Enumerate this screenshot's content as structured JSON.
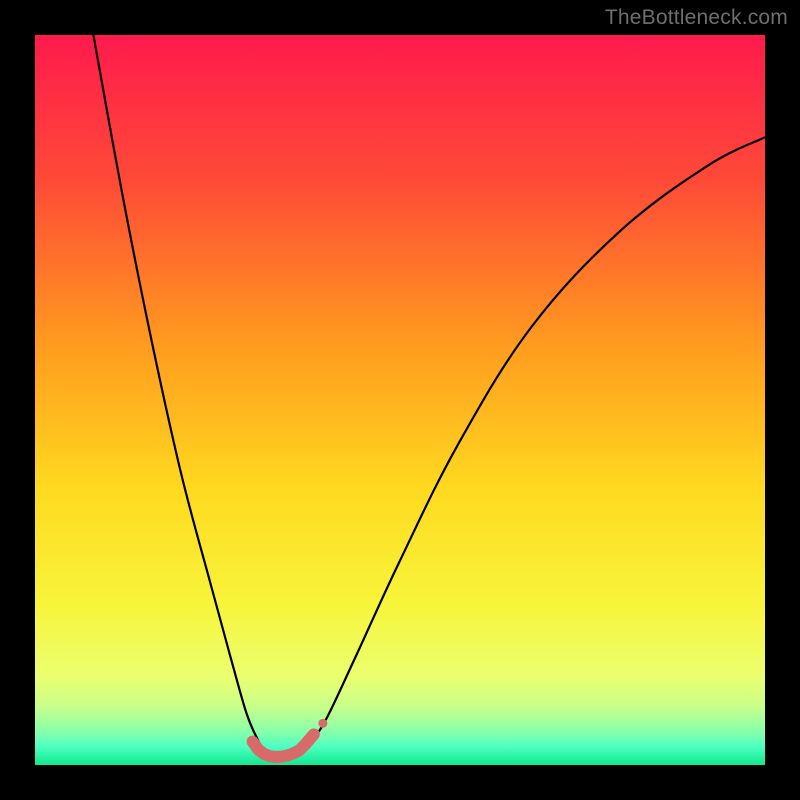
{
  "watermark": "TheBottleneck.com",
  "chart_data": {
    "type": "line",
    "title": "",
    "xlabel": "",
    "ylabel": "",
    "xlim": [
      0,
      100
    ],
    "ylim": [
      0,
      100
    ],
    "grid": false,
    "legend": false,
    "series": [
      {
        "name": "bottleneck-curve",
        "color": "#000000",
        "x": [
          8,
          12,
          16,
          20,
          24,
          27,
          29,
          30.5,
          31.5,
          32.5,
          33.5,
          35,
          36.5,
          38,
          40,
          44,
          50,
          58,
          68,
          80,
          92,
          100
        ],
        "y": [
          100,
          78,
          58,
          40,
          25,
          14,
          7,
          3.5,
          1.8,
          1.2,
          1.2,
          1.4,
          2.0,
          3.5,
          6.5,
          15,
          28,
          44,
          60,
          73,
          82,
          86
        ]
      }
    ],
    "markers": {
      "name": "highlight-band",
      "color": "#d86a6a",
      "stroke_width": 12,
      "x": [
        29.8,
        30.6,
        31.4,
        32.2,
        33.0,
        33.8,
        34.6,
        35.4,
        36.2,
        37.0,
        38.2
      ],
      "y": [
        3.2,
        2.1,
        1.5,
        1.2,
        1.1,
        1.15,
        1.3,
        1.6,
        2.0,
        2.8,
        4.2
      ]
    },
    "gradient_stops": [
      {
        "pos": 0.0,
        "color": "#ff1a4d"
      },
      {
        "pos": 0.2,
        "color": "#ff4a37"
      },
      {
        "pos": 0.42,
        "color": "#ff9a1f"
      },
      {
        "pos": 0.62,
        "color": "#ffd91f"
      },
      {
        "pos": 0.78,
        "color": "#f7f53a"
      },
      {
        "pos": 0.88,
        "color": "#eaff70"
      },
      {
        "pos": 0.92,
        "color": "#c8ff8a"
      },
      {
        "pos": 0.955,
        "color": "#86ffab"
      },
      {
        "pos": 0.975,
        "color": "#4cffc0"
      },
      {
        "pos": 1.0,
        "color": "#11e88e"
      }
    ]
  }
}
